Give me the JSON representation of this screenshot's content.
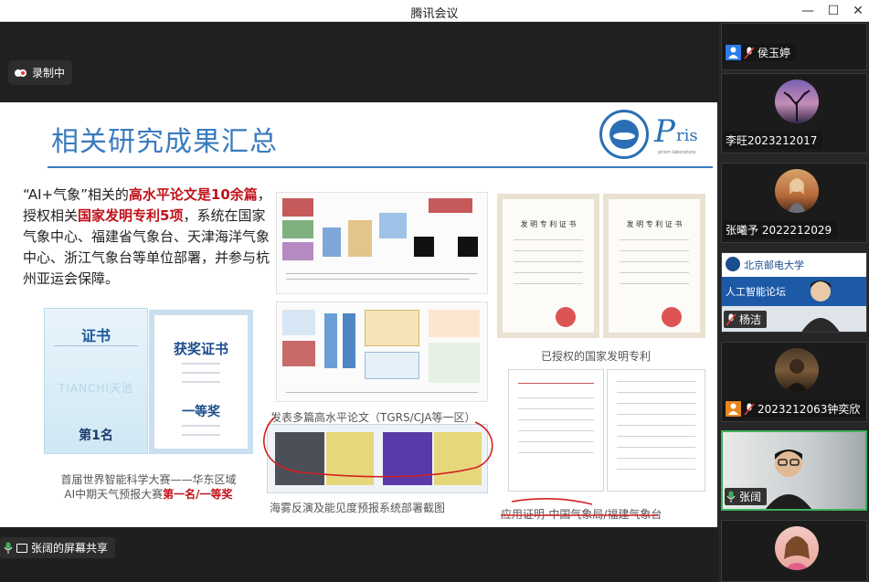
{
  "window": {
    "title": "腾讯会议",
    "controls": {
      "minimize": "—",
      "maximize": "☐",
      "close": "✕"
    }
  },
  "recording": {
    "label": "录制中"
  },
  "screen_share": {
    "label": "张阔的屏幕共享"
  },
  "slide": {
    "title": "相关研究成果汇总",
    "body": {
      "p1": "“AI+气象”相关的",
      "red1": "高水平论文是10余篇",
      "p2": "，授权相关",
      "red2": "国家发明专利5项",
      "p3": "，系统在国家气象中心、福建省气象台、天津海洋气象中心、浙江气象台等单位部署，并参与杭州亚运会保障。"
    },
    "cert_left": {
      "title": "证书",
      "watermark": "TIANCHI天池",
      "rank": "第1名"
    },
    "cert_right": {
      "title": "获奖证书",
      "award": "一等奖"
    },
    "caption_left": {
      "line1": "首届世界智能科学大赛——华东区域",
      "line2_prefix": "AI中期天气预报大赛",
      "line2_red": "第一名/一等奖"
    },
    "caption_papers": "发表多篇高水平论文（TGRS/CJA等一区）",
    "caption_system": "海雾反演及能见度预报系统部署截图",
    "caption_patents": "已授权的国家发明专利",
    "caption_application": "应用证明-中国气象局/福建气象台"
  },
  "participants": [
    {
      "name": "侯玉婷",
      "icon": "user-icon",
      "mic": "muted"
    },
    {
      "name": "李旺2023212017",
      "mic": "none"
    },
    {
      "name": "张曦予 2022212029",
      "mic": "none"
    },
    {
      "name": "杨洁",
      "banner": "北京邮电大学",
      "subbanner": "人工智能论坛",
      "mic": "muted"
    },
    {
      "name": "2023212063钟奕欣",
      "icon": "user-icon",
      "mic": "muted"
    },
    {
      "name": "张阔",
      "mic": "on",
      "active": true
    },
    {
      "name": "",
      "mic": "none"
    }
  ],
  "colors": {
    "accent": "#3a7bbf",
    "highlight_red": "#c0111a",
    "active_speaker": "#3fb15a",
    "user_icon_blue": "#2d7de8",
    "user_icon_orange": "#e8861f"
  }
}
